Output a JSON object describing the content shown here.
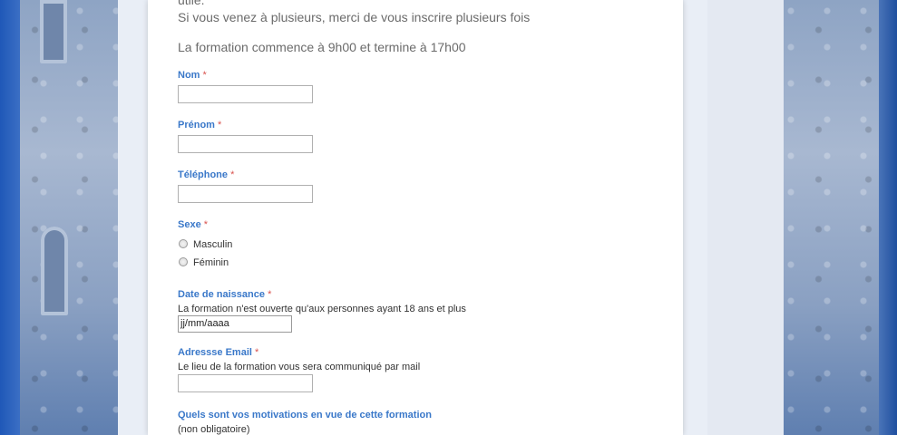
{
  "intro": {
    "line1": "utile.",
    "line2": "Si vous venez à plusieurs, merci de vous inscrire plusieurs fois",
    "line3": "La formation commence à 9h00 et termine à 17h00"
  },
  "form": {
    "required_mark": "*",
    "nom": {
      "label": "Nom"
    },
    "prenom": {
      "label": "Prénom"
    },
    "telephone": {
      "label": "Téléphone"
    },
    "sexe": {
      "label": "Sexe",
      "options": [
        "Masculin",
        "Féminin"
      ]
    },
    "date_naissance": {
      "label": "Date de naissance",
      "hint": "La formation n'est ouverte qu'aux personnes ayant 18 ans et plus",
      "placeholder": "jj/mm/aaaa"
    },
    "email": {
      "label": "Adressse Email",
      "hint": "Le lieu de la formation vous sera communiqué par mail"
    },
    "motivations": {
      "label": "Quels sont vos motivations en vue de cette formation",
      "hint": "(non obligatoire)"
    }
  },
  "colors": {
    "label_blue": "#3a78c9",
    "required_red": "#d9534f",
    "intro_gray": "#6b6b6b"
  }
}
